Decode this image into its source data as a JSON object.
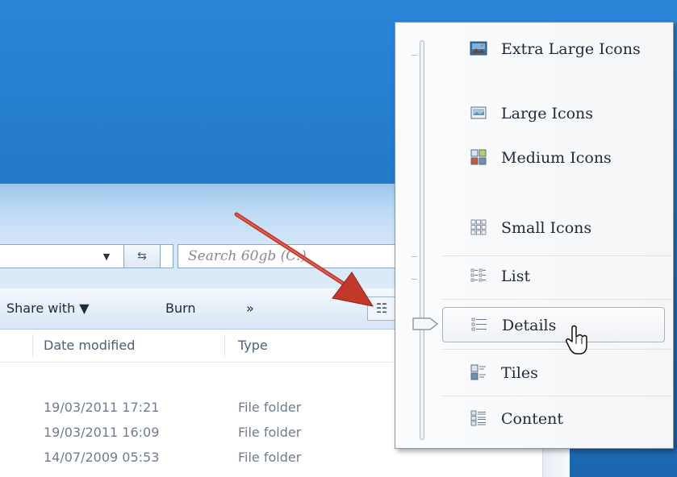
{
  "address_bar": {
    "dropdown_glyph": "▼",
    "refresh_glyph": "⇆"
  },
  "search": {
    "placeholder": "Search 60gb (C:)"
  },
  "toolbar": {
    "share_with": "Share with ▼",
    "burn": "Burn",
    "more": "»",
    "view_glyph": "☷"
  },
  "columns": {
    "date_modified": "Date modified",
    "type": "Type"
  },
  "rows": [
    {
      "date": "19/03/2011 17:21",
      "type": "File folder"
    },
    {
      "date": "19/03/2011 16:09",
      "type": "File folder"
    },
    {
      "date": "14/07/2009 05:53",
      "type": "File folder"
    }
  ],
  "view_menu": {
    "selected": "Details",
    "items": [
      {
        "label": "Extra Large Icons",
        "icon": "extra-large-icons-icon"
      },
      {
        "label": "Large Icons",
        "icon": "large-icons-icon"
      },
      {
        "label": "Medium Icons",
        "icon": "medium-icons-icon"
      },
      {
        "label": "Small Icons",
        "icon": "small-icons-icon"
      },
      {
        "label": "List",
        "icon": "list-view-icon"
      },
      {
        "label": "Details",
        "icon": "details-view-icon"
      },
      {
        "label": "Tiles",
        "icon": "tiles-view-icon"
      },
      {
        "label": "Content",
        "icon": "content-view-icon"
      }
    ]
  },
  "colors": {
    "desktop": "#2378c8",
    "annotation_arrow": "#c2382a",
    "menu_border": "#8e979f"
  }
}
